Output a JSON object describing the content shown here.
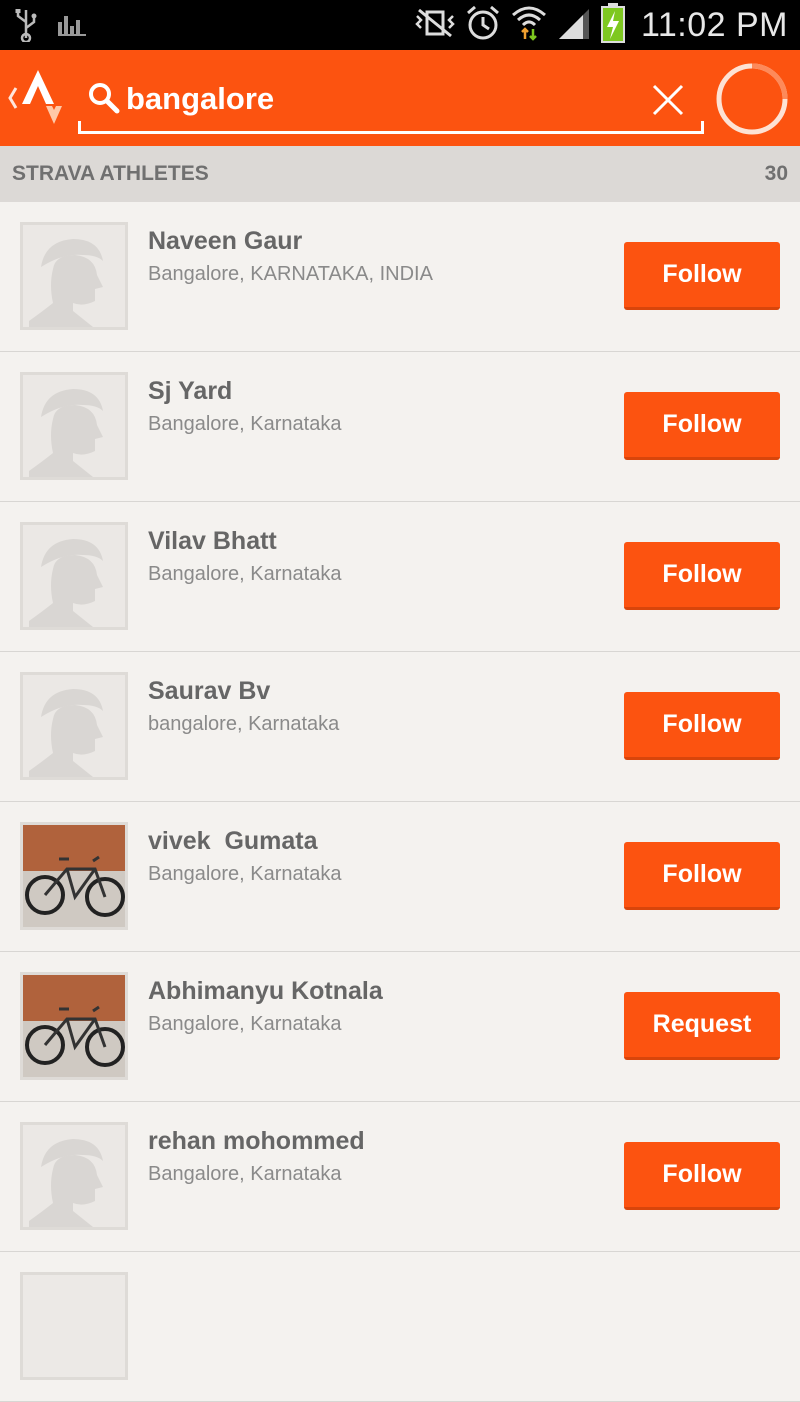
{
  "status_bar": {
    "time": "11:02 PM",
    "icons": [
      "usb-icon",
      "signal-bars-icon",
      "no-vibrate-icon",
      "alarm-icon",
      "wifi-icon",
      "cell-signal-icon",
      "battery-charging-icon"
    ]
  },
  "search": {
    "query": "bangalore",
    "placeholder": "Search"
  },
  "section": {
    "title": "STRAVA ATHLETES",
    "count": "30"
  },
  "athletes": [
    {
      "name": "Naveen Gaur",
      "location": "Bangalore, KARNATAKA, INDIA",
      "button": "Follow",
      "avatar": "default"
    },
    {
      "name": "Sj Yard",
      "location": "Bangalore, Karnataka",
      "button": "Follow",
      "avatar": "default"
    },
    {
      "name": "Vilav Bhatt",
      "location": "Bangalore, Karnataka",
      "button": "Follow",
      "avatar": "default"
    },
    {
      "name": "Saurav Bv",
      "location": "bangalore, Karnataka",
      "button": "Follow",
      "avatar": "default"
    },
    {
      "name": "vivek  Gumata",
      "location": "Bangalore, Karnataka",
      "button": "Follow",
      "avatar": "bike"
    },
    {
      "name": "Abhimanyu Kotnala",
      "location": "Bangalore, Karnataka",
      "button": "Request",
      "avatar": "bike"
    },
    {
      "name": "rehan mohommed",
      "location": "Bangalore, Karnataka",
      "button": "Follow",
      "avatar": "default"
    }
  ],
  "colors": {
    "accent": "#fc5310",
    "background": "#f4f2ef",
    "section_header": "#dcd9d6"
  }
}
